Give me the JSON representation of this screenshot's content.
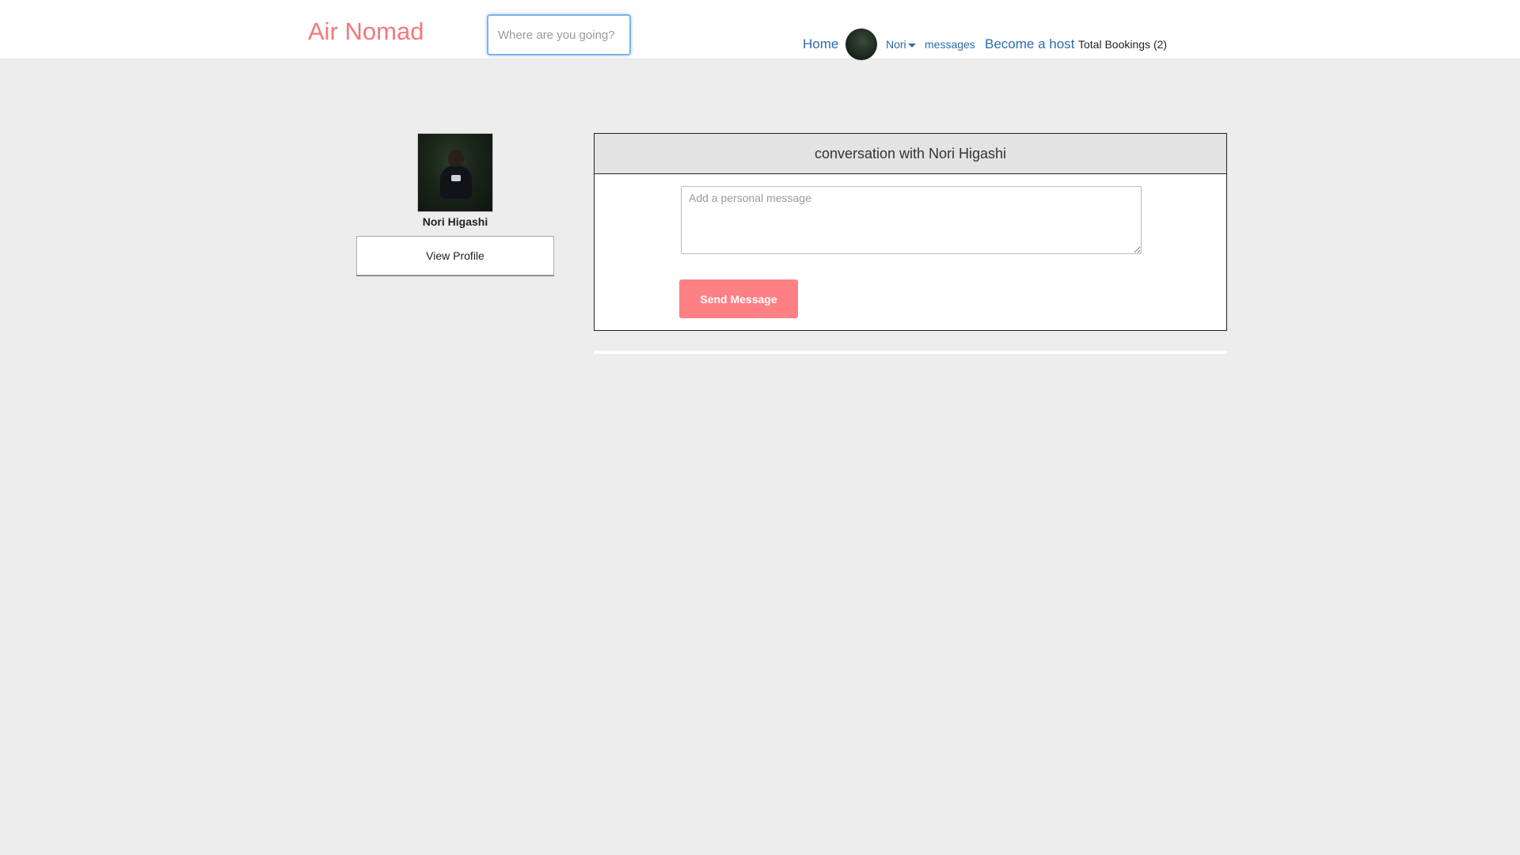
{
  "navbar": {
    "brand": "Air Nomad",
    "search_placeholder": "Where are you going?",
    "home_label": "Home",
    "user_label": "Nori",
    "messages_label": "messages",
    "host_label": "Become a host",
    "bookings_label": "Total Bookings (2)"
  },
  "sidebar": {
    "name": "Nori Higashi",
    "view_profile_label": "View Profile"
  },
  "conversation": {
    "title": "conversation with Nori Higashi",
    "message_placeholder": "Add a personal message",
    "send_label": "Send Message"
  },
  "colors": {
    "brand": "#f4787c",
    "link": "#2c6cb0",
    "send_button": "#fd8085",
    "page_background": "#ededed"
  }
}
